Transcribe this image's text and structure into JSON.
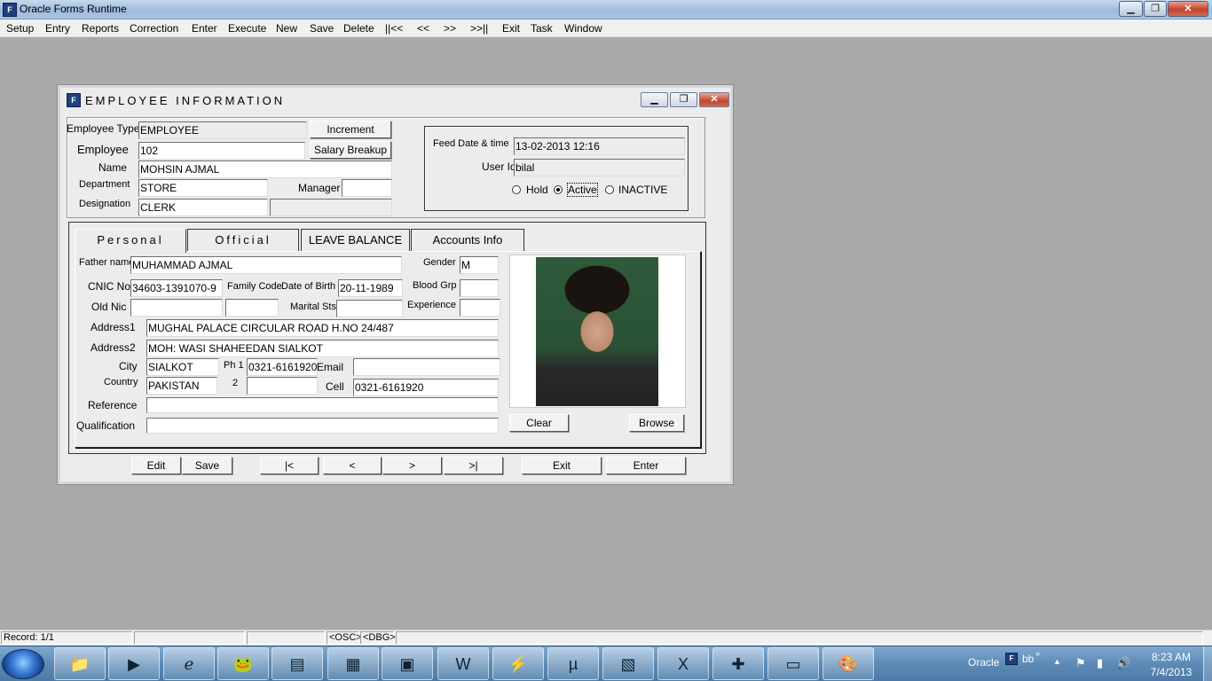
{
  "window": {
    "title": "Oracle Forms Runtime",
    "min": "▁",
    "max": "❐",
    "close": "✕"
  },
  "menu": [
    "Setup",
    "Entry",
    "Reports",
    "Correction",
    "Enter",
    "Execute",
    "New",
    "Save",
    "Delete",
    "||<<",
    "<<",
    ">>",
    ">>||",
    "Exit",
    "Task",
    "Window"
  ],
  "form": {
    "title": "EMPLOYEE INFORMATION",
    "employee_type_label": "Employee Type",
    "employee_type": "EMPLOYEE",
    "increment_btn": "Increment",
    "salary_breakup_btn": "Salary Breakup",
    "employee_label": "Employee",
    "employee": "102",
    "name_label": "Name",
    "name": "MOHSIN AJMAL",
    "department_label": "Department",
    "department": "STORE",
    "manager_label": "Manager",
    "manager": "",
    "designation_label": "Designation",
    "designation": "CLERK",
    "feed_date_label": "Feed Date & time",
    "feed_date": "13-02-2013 12:16",
    "user_id_label": "User Id",
    "user_id": "bilal",
    "status_options": [
      "Hold",
      "Active",
      "INACTIVE"
    ],
    "status_selected": "Active"
  },
  "tabs": [
    "Personal",
    "Official",
    "LEAVE BALANCE",
    "Accounts Info"
  ],
  "personal": {
    "father_name_label": "Father name",
    "father_name": "MUHAMMAD AJMAL",
    "gender_label": "Gender",
    "gender": "M",
    "cnic_label": "CNIC No",
    "cnic": "34603-1391070-9",
    "family_code_label": "Family Code",
    "dob_label": "Date of Birth",
    "dob": "20-11-1989",
    "blood_grp_label": "Blood Grp",
    "blood_grp": "",
    "old_nic_label": "Old Nic",
    "old_nic": "",
    "marital_label": "Marital Sts",
    "marital": "",
    "experience_label": "Experience",
    "experience": "",
    "address1_label": "Address1",
    "address1": "MUGHAL PALACE CIRCULAR ROAD H.NO 24/487",
    "address2_label": "Address2",
    "address2": "MOH: WASI SHAHEEDAN SIALKOT",
    "city_label": "City",
    "city": "SIALKOT",
    "ph1_label": "Ph 1",
    "ph1": "0321-6161920",
    "email_label": "Email",
    "email": "",
    "country_label": "Country",
    "country": "PAKISTAN",
    "ph2_label": "2",
    "ph2": "",
    "cell_label": "Cell",
    "cell": "0321-6161920",
    "reference_label": "Reference",
    "reference": "",
    "qualification_label": "Qualification",
    "qualification": "",
    "clear_btn": "Clear",
    "browse_btn": "Browse"
  },
  "nav": {
    "edit": "Edit",
    "save": "Save",
    "first": "|<",
    "prev": "<",
    "next": ">",
    "last": ">|",
    "exit": "Exit",
    "enter": "Enter"
  },
  "statusbar": {
    "record": "Record: 1/1",
    "osc": "<OSC>",
    "dbg": "<DBG>"
  },
  "taskbar": {
    "apps": [
      "folder-icon",
      "media-player-icon",
      "internet-explorer-icon",
      "frog-icon",
      "forms-icon",
      "forms-clock-icon",
      "terminal-icon",
      "word-icon",
      "flash-icon",
      "utorrent-icon",
      "report-icon",
      "excel-icon",
      "health-icon",
      "monitor-icon",
      "paint-icon"
    ],
    "tray_lang": "Oracle",
    "tray_user": "bb",
    "time": "8:23 AM",
    "date": "7/4/2013"
  }
}
